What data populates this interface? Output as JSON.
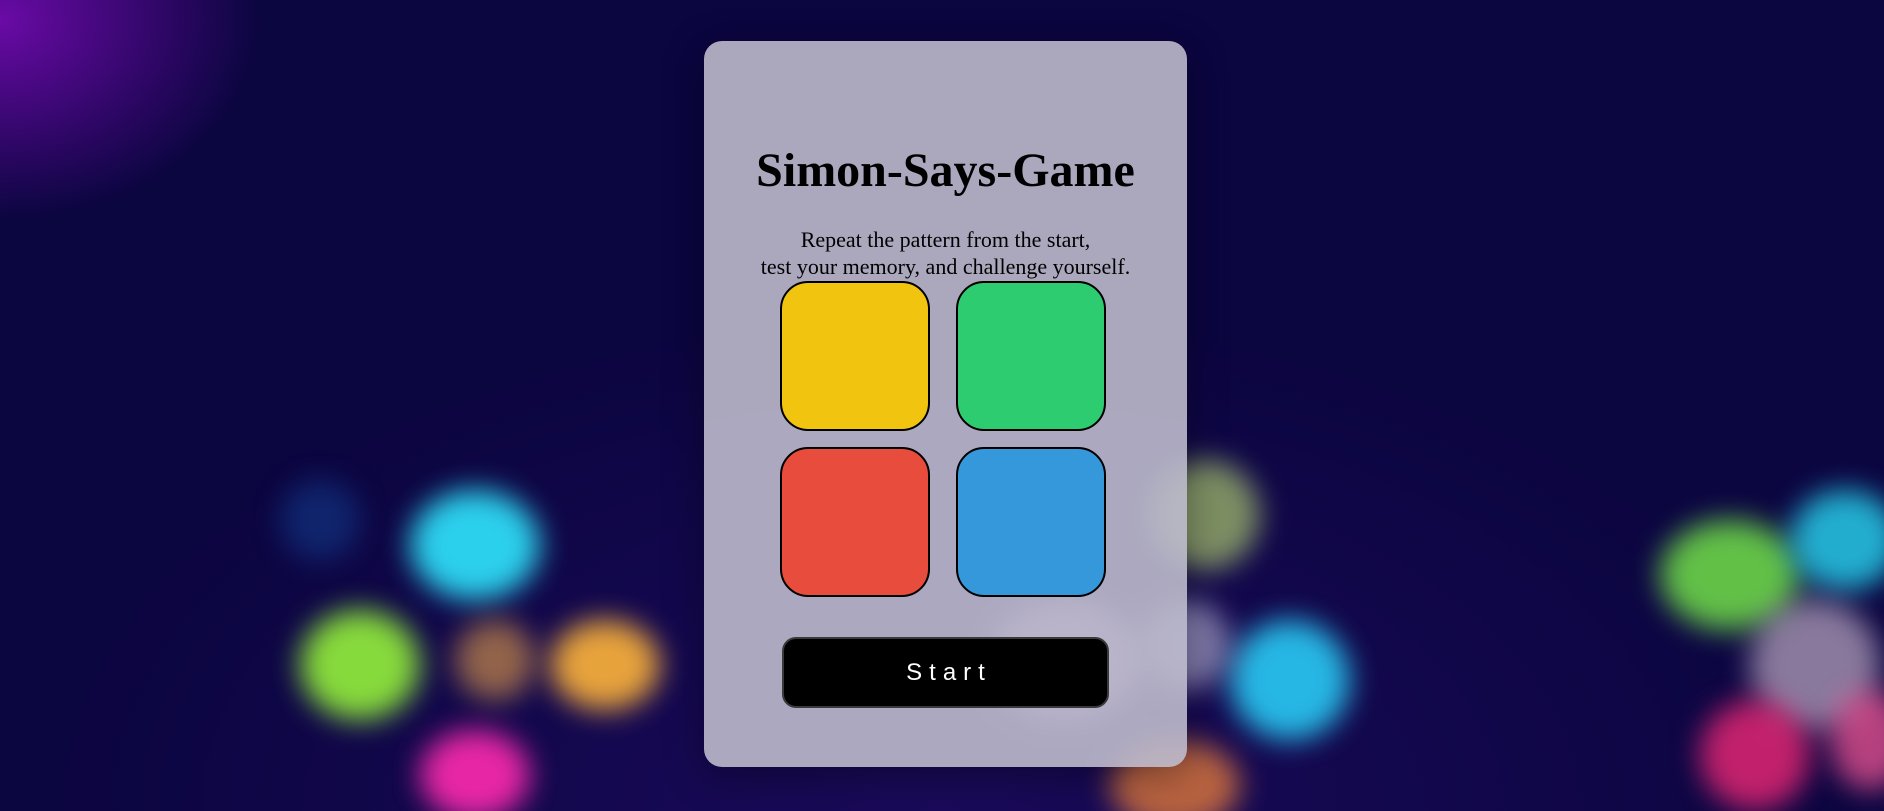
{
  "game": {
    "title": "Simon-Says-Game",
    "subtitle_line1": "Repeat the pattern from the start,",
    "subtitle_line2": "test your memory, and challenge yourself.",
    "start_label": "Start"
  },
  "pads": [
    {
      "name": "yellow",
      "color": "#f1c40f"
    },
    {
      "name": "green",
      "color": "#2ecc71"
    },
    {
      "name": "red",
      "color": "#e74c3c"
    },
    {
      "name": "blue",
      "color": "#3498db"
    }
  ],
  "colors": {
    "background": "#0b0540",
    "card": "#bcbacc",
    "button": "#000000"
  }
}
